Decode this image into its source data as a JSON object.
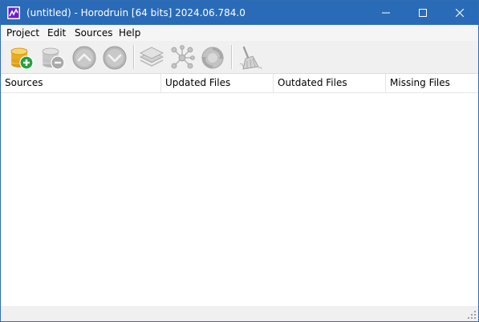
{
  "window": {
    "title": "(untitled) - Horodruin [64 bits] 2024.06.784.0"
  },
  "menu": {
    "items": [
      {
        "label": "Project"
      },
      {
        "label": "Edit"
      },
      {
        "label": "Sources"
      },
      {
        "label": "Help"
      }
    ]
  },
  "toolbar": {
    "buttons": [
      {
        "icon": "add-source-icon",
        "enabled": true
      },
      {
        "icon": "remove-source-icon",
        "enabled": false
      },
      {
        "icon": "move-up-icon",
        "enabled": false
      },
      {
        "icon": "move-down-icon",
        "enabled": false
      },
      {
        "icon": "layers-icon",
        "enabled": false
      },
      {
        "icon": "network-icon",
        "enabled": false
      },
      {
        "icon": "refresh-icon",
        "enabled": false
      },
      {
        "icon": "cleanup-broom-icon",
        "enabled": false
      }
    ]
  },
  "list": {
    "columns": [
      {
        "label": "Sources"
      },
      {
        "label": "Updated Files"
      },
      {
        "label": "Outdated Files"
      },
      {
        "label": "Missing Files"
      }
    ],
    "rows": []
  },
  "colors": {
    "titlebar": "#2a6bb8",
    "app_icon": "#6a1fd0"
  }
}
